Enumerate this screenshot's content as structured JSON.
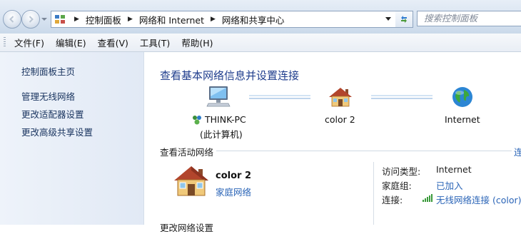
{
  "address_bar": {
    "breadcrumbs": [
      "控制面板",
      "网络和 Internet",
      "网络和共享中心"
    ],
    "search_placeholder": "搜索控制面板"
  },
  "menu": [
    "文件(F)",
    "编辑(E)",
    "查看(V)",
    "工具(T)",
    "帮助(H)"
  ],
  "sidebar": {
    "home": "控制面板主页",
    "links": [
      "管理无线网络",
      "更改适配器设置",
      "更改高级共享设置"
    ]
  },
  "main": {
    "title": "查看基本网络信息并设置连接",
    "map": {
      "computer_name": "THINK-PC",
      "computer_sub": "(此计算机)",
      "network_name": "color  2",
      "internet": "Internet"
    },
    "active_section": {
      "heading": "查看活动网络",
      "link": "连"
    },
    "active_network": {
      "name": "color  2",
      "type": "家庭网络",
      "access_type_label": "访问类型:",
      "access_type_value": "Internet",
      "homegroup_label": "家庭组:",
      "homegroup_value": "已加入",
      "connection_label": "连接:",
      "connection_value": "无线网络连接 (color)"
    },
    "bottom_heading": "更改网络设置"
  }
}
